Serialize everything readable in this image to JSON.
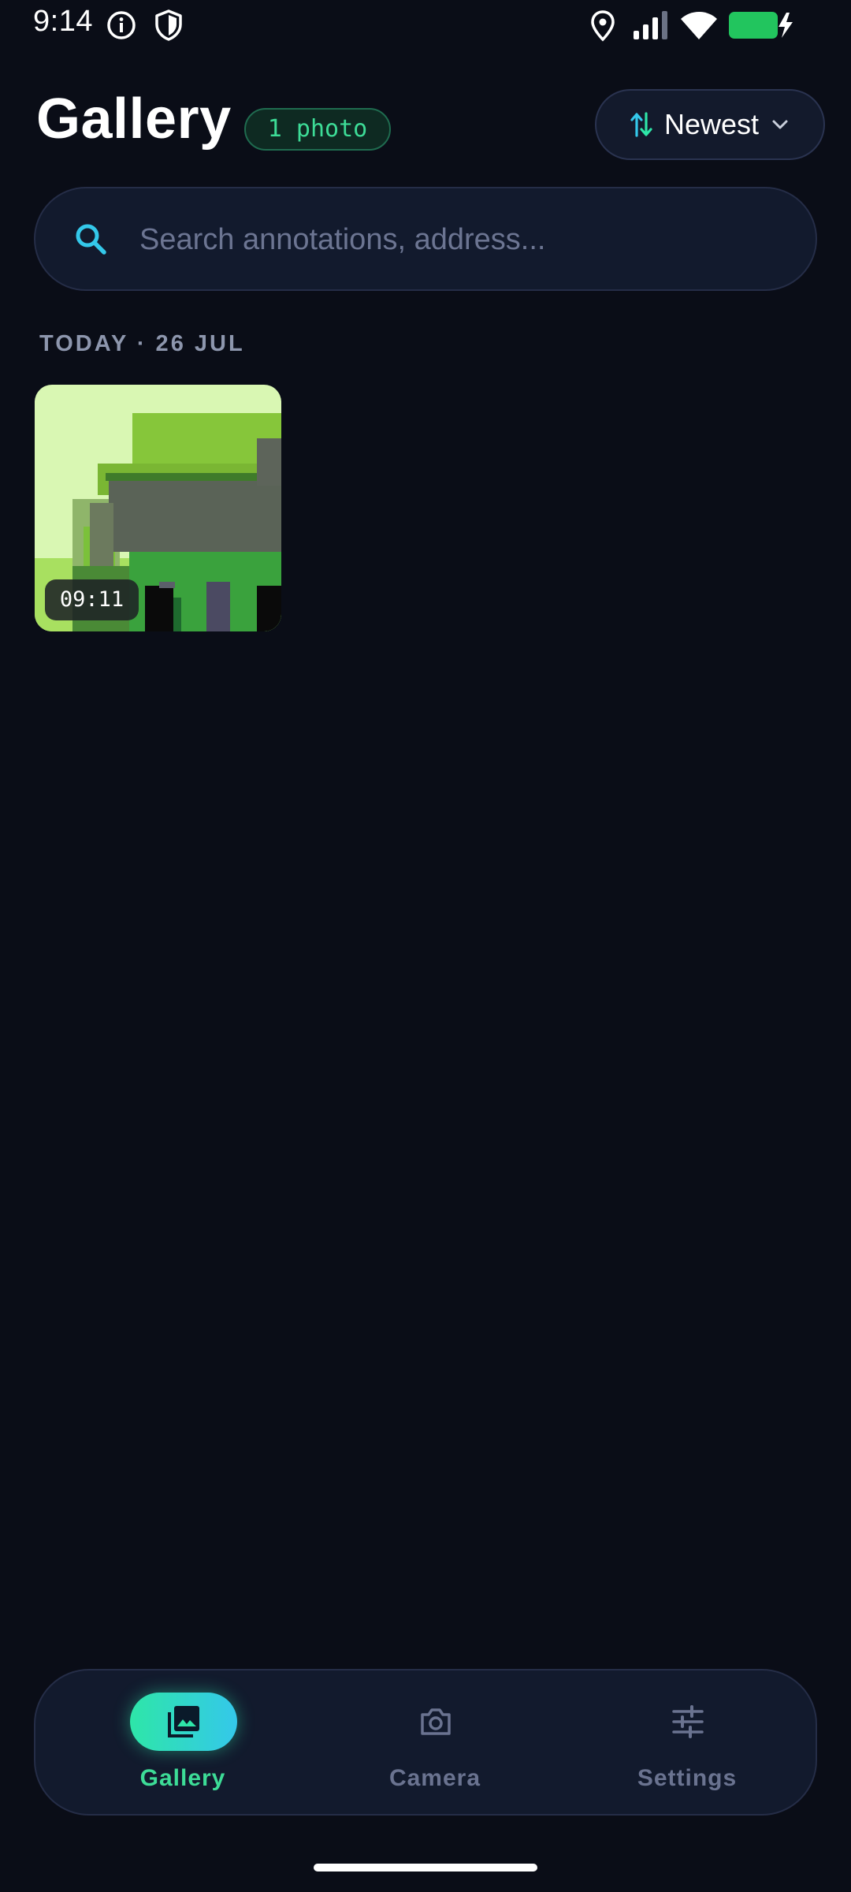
{
  "status_bar": {
    "time": "9:14",
    "icons": [
      "info-icon",
      "shield-icon",
      "location-pin-icon",
      "cellular-signal-icon",
      "wifi-icon",
      "battery-charging-icon"
    ],
    "battery_color": "#22c55e"
  },
  "header": {
    "title": "Gallery",
    "count_badge": "1 photo",
    "sort_label": "Newest",
    "sort_icon": "sort-arrows-icon",
    "sort_chevron": "chevron-down-icon"
  },
  "search": {
    "value": "",
    "placeholder": "Search annotations, address..."
  },
  "sections": [
    {
      "header": "TODAY · 26 JUL",
      "photos": [
        {
          "time": "09:11"
        }
      ]
    }
  ],
  "bottom_nav": {
    "items": [
      {
        "label": "Gallery",
        "icon": "gallery-icon",
        "active": true
      },
      {
        "label": "Camera",
        "icon": "camera-icon",
        "active": false
      },
      {
        "label": "Settings",
        "icon": "sliders-icon",
        "active": false
      }
    ]
  },
  "colors": {
    "background": "#0a0d17",
    "surface": "#121a2d",
    "accent_green": "#3ddc97",
    "accent_cyan": "#34c8ea",
    "muted_text": "#6a7390"
  }
}
